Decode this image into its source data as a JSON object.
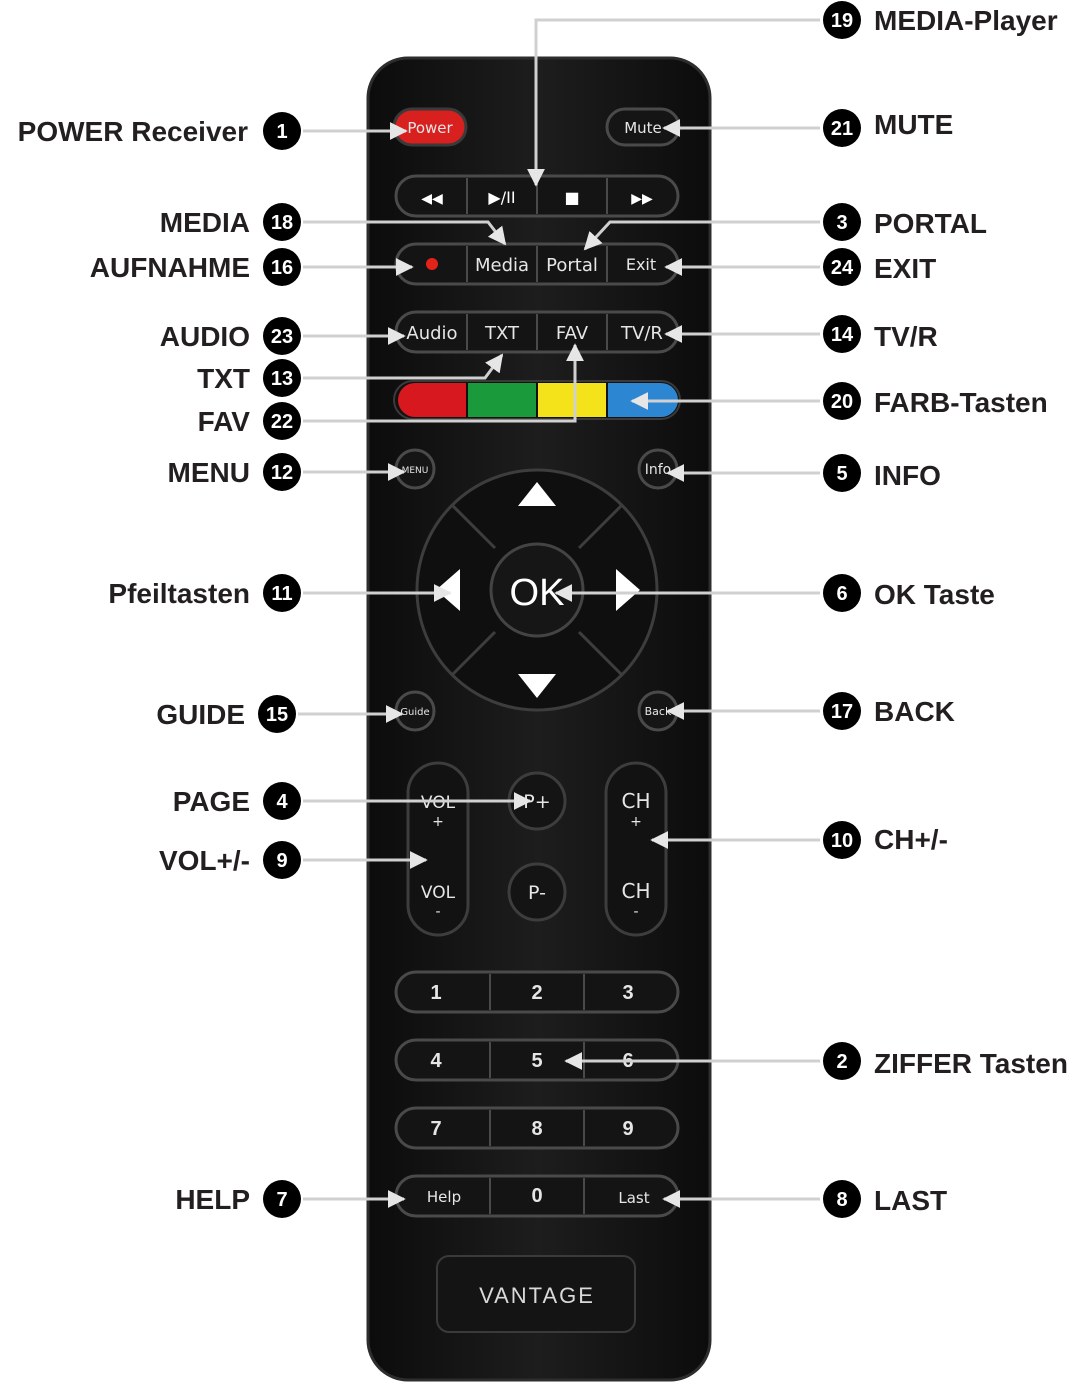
{
  "remote": {
    "power": "Power",
    "mute": "Mute",
    "transport": {
      "rewind": "◀◀",
      "play_pause": "▶/II",
      "stop": "■",
      "forward": "▶▶"
    },
    "row_record": {
      "media": "Media",
      "portal": "Portal",
      "exit": "Exit"
    },
    "row_audio": {
      "audio": "Audio",
      "txt": "TXT",
      "fav": "FAV",
      "tvr": "TV/R"
    },
    "colors": {
      "red": "#d7191f",
      "green": "#1a9a3a",
      "yellow": "#f4e31a",
      "blue": "#2d86d2"
    },
    "menu": "MENU",
    "info": "Info",
    "ok": "OK",
    "guide": "Guide",
    "back": "Back",
    "vol_top": "VOL",
    "vol_top_sign": "+",
    "vol_bottom": "VOL",
    "vol_bottom_sign": "-",
    "p_plus": "P+",
    "p_minus": "P-",
    "ch_top": "CH",
    "ch_top_sign": "+",
    "ch_bottom": "CH",
    "ch_bottom_sign": "-",
    "digits": [
      "1",
      "2",
      "3",
      "4",
      "5",
      "6",
      "7",
      "8",
      "9"
    ],
    "help": "Help",
    "zero": "0",
    "last": "Last",
    "brand": "VANTAGE"
  },
  "callouts": {
    "left": [
      {
        "num": "1",
        "text": "POWER Receiver"
      },
      {
        "num": "18",
        "text": "MEDIA"
      },
      {
        "num": "16",
        "text": "AUFNAHME"
      },
      {
        "num": "23",
        "text": "AUDIO"
      },
      {
        "num": "13",
        "text": "TXT"
      },
      {
        "num": "22",
        "text": "FAV"
      },
      {
        "num": "12",
        "text": "MENU"
      },
      {
        "num": "11",
        "text": "Pfeiltasten"
      },
      {
        "num": "15",
        "text": "GUIDE"
      },
      {
        "num": "4",
        "text": "PAGE"
      },
      {
        "num": "9",
        "text": "VOL+/-"
      },
      {
        "num": "7",
        "text": "HELP"
      }
    ],
    "right": [
      {
        "num": "19",
        "text": "MEDIA-Player"
      },
      {
        "num": "21",
        "text": "MUTE"
      },
      {
        "num": "3",
        "text": "PORTAL"
      },
      {
        "num": "24",
        "text": "EXIT"
      },
      {
        "num": "14",
        "text": "TV/R"
      },
      {
        "num": "20",
        "text": "FARB-Tasten"
      },
      {
        "num": "5",
        "text": "INFO"
      },
      {
        "num": "6",
        "text": "OK Taste"
      },
      {
        "num": "17",
        "text": "BACK"
      },
      {
        "num": "10",
        "text": "CH+/-"
      },
      {
        "num": "2",
        "text": "ZIFFER Tasten"
      },
      {
        "num": "8",
        "text": "LAST"
      }
    ]
  }
}
